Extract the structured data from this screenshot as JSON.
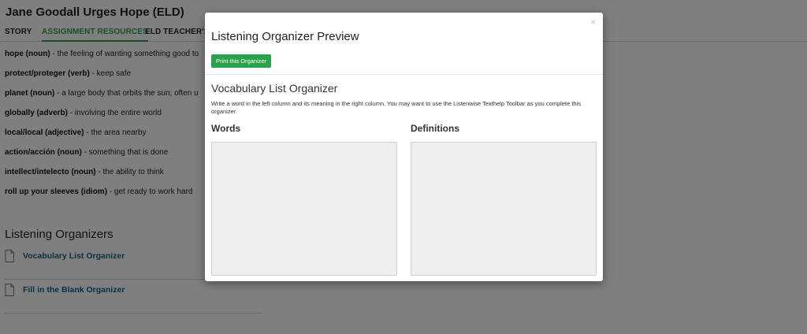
{
  "page": {
    "title": "Jane Goodall Urges Hope (ELD)",
    "tabs": [
      {
        "label": "STORY",
        "active": false
      },
      {
        "label": "ASSIGNMENT RESOURCES",
        "active": true
      },
      {
        "label": "ELD TEACHER'S G",
        "active": false
      }
    ]
  },
  "vocabulary": [
    {
      "term": "hope (noun)",
      "definition": " - the feeling of wanting something good to"
    },
    {
      "term": "protect/proteger (verb)",
      "definition": " - keep safe"
    },
    {
      "term": "planet (noun)",
      "definition": " - a large body that orbits the sun; often u"
    },
    {
      "term": "globally (adverb)",
      "definition": " - involving the entire world"
    },
    {
      "term": "local/local (adjective)",
      "definition": " - the area nearby"
    },
    {
      "term": "action/acción (noun)",
      "definition": " - something that is done"
    },
    {
      "term": "intellect/intelecto (noun)",
      "definition": " - the ability to think"
    },
    {
      "term": "roll up your sleeves (idiom)",
      "definition": " - get ready to work hard"
    }
  ],
  "listening_organizers": {
    "heading": "Listening Organizers",
    "items": [
      {
        "label": "Vocabulary List Organizer",
        "icon": "document-icon"
      },
      {
        "label": "Fill in the Blank Organizer",
        "icon": "document-icon"
      }
    ]
  },
  "modal": {
    "title": "Listening Organizer Preview",
    "close_glyph": "×",
    "print_label": "Print this Organizer",
    "organizer_title": "Vocabulary List Organizer",
    "instructions": "Write a word in the left column and its meaning in the right column. You may want to use the Listenwise Texthelp Toolbar as you complete this organizer.",
    "columns": [
      {
        "header": "Words"
      },
      {
        "header": "Definitions"
      }
    ]
  },
  "colors": {
    "accent_green": "#2aa14a",
    "active_tab": "#2e9c4b",
    "link_blue": "#1a5e87",
    "overlay": "rgba(0,0,0,0.5)"
  }
}
